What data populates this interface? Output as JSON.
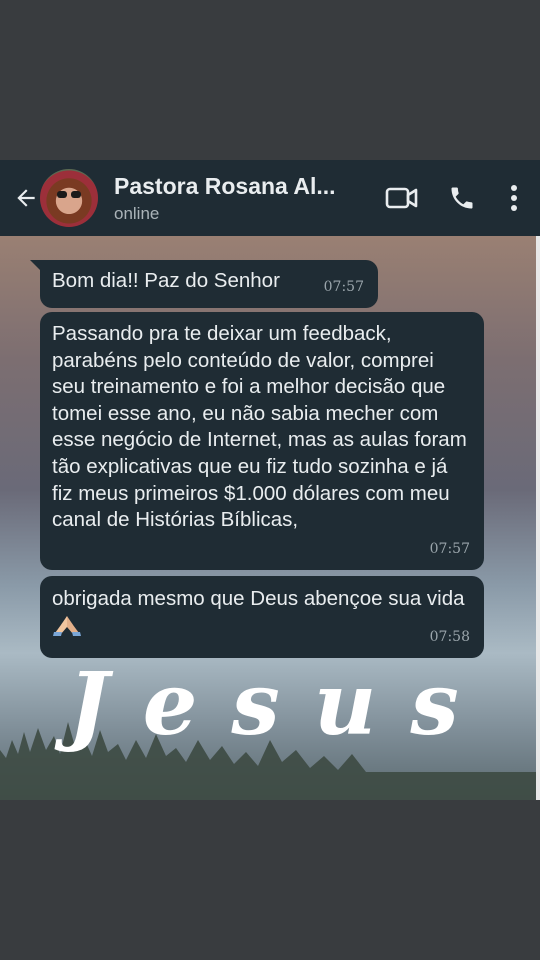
{
  "header": {
    "contact_name": "Pastora Rosana Al...",
    "status": "online"
  },
  "messages": [
    {
      "text": "Bom dia!! Paz do Senhor",
      "time": "07:57"
    },
    {
      "text": "Passando pra te deixar um feedback, parabéns pelo conteúdo de valor, comprei seu treinamento e foi a melhor decisão que tomei esse ano, eu não sabia mecher com esse negócio de Internet, mas as aulas foram tão explicativas que eu fiz tudo sozinha e já fiz meus primeiros $1.000 dólares com meu canal de Histórias Bíblicas,",
      "time": "07:57"
    },
    {
      "text": "obrigada mesmo que Deus abençoe sua vida",
      "emoji": "folded-hands-icon",
      "time": "07:58"
    }
  ],
  "wallpaper": {
    "word": "Jesus"
  },
  "icons": {
    "back": "arrow-left-icon",
    "video": "video-call-icon",
    "call": "phone-icon",
    "menu": "more-vertical-icon"
  },
  "colors": {
    "header_bg": "#1f2c34",
    "bubble_bg": "#1f2c34",
    "text": "#e9edef",
    "time": "#9aa5ab",
    "frame_bg": "#393c3f"
  }
}
